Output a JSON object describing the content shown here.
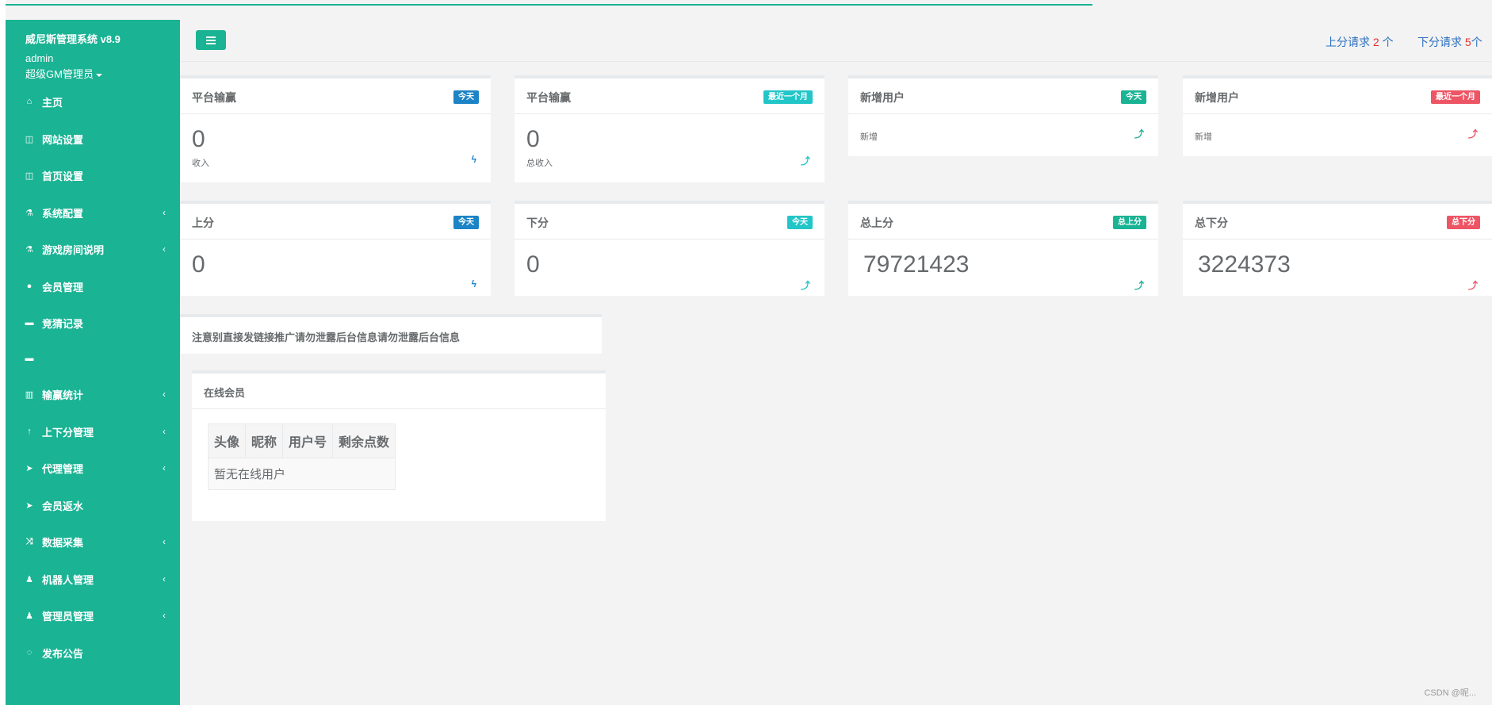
{
  "app": {
    "title": "威尼斯管理系统 v8.9",
    "user": "admin",
    "role": "超级GM管理员"
  },
  "nav": [
    {
      "label": "主页",
      "icon": "home-icon",
      "glyph": "⌂",
      "has_arrow": false,
      "arrow": ""
    },
    {
      "label": "网站设置",
      "icon": "columns-icon",
      "glyph": "◫",
      "has_arrow": false,
      "arrow": ""
    },
    {
      "label": "首页设置",
      "icon": "columns-icon",
      "glyph": "◫",
      "has_arrow": false,
      "arrow": ""
    },
    {
      "label": "系统配置",
      "icon": "flask-icon",
      "glyph": "⚗",
      "has_arrow": true,
      "arrow": "‹"
    },
    {
      "label": "游戏房间说明",
      "icon": "flask-icon",
      "glyph": "⚗",
      "has_arrow": true,
      "arrow": "‹"
    },
    {
      "label": "会员管理",
      "icon": "user-icon",
      "glyph": "●",
      "has_arrow": false,
      "arrow": ""
    },
    {
      "label": "竞猜记录",
      "icon": "car-icon",
      "glyph": "▬",
      "has_arrow": false,
      "arrow": ""
    },
    {
      "label": "",
      "icon": "car-icon",
      "glyph": "▬",
      "has_arrow": false,
      "arrow": ""
    },
    {
      "label": "输赢统计",
      "icon": "bar-chart-icon",
      "glyph": "▥",
      "has_arrow": true,
      "arrow": "‹"
    },
    {
      "label": "上下分管理",
      "icon": "level-up-icon",
      "glyph": "↑",
      "has_arrow": true,
      "arrow": "‹"
    },
    {
      "label": "代理管理",
      "icon": "paper-plane-icon",
      "glyph": "➤",
      "has_arrow": true,
      "arrow": "‹"
    },
    {
      "label": "会员返水",
      "icon": "paper-plane-icon",
      "glyph": "➤",
      "has_arrow": false,
      "arrow": ""
    },
    {
      "label": "数据采集",
      "icon": "random-icon",
      "glyph": "⤨",
      "has_arrow": true,
      "arrow": "‹"
    },
    {
      "label": "机器人管理",
      "icon": "male-icon",
      "glyph": "♟",
      "has_arrow": true,
      "arrow": "‹"
    },
    {
      "label": "管理员管理",
      "icon": "male-icon",
      "glyph": "♟",
      "has_arrow": true,
      "arrow": "‹"
    },
    {
      "label": "发布公告",
      "icon": "comment-icon",
      "glyph": "◌",
      "has_arrow": false,
      "arrow": ""
    }
  ],
  "header": {
    "up_request": {
      "label": "上分请求 ",
      "count": "2",
      "unit": " 个"
    },
    "down_request": {
      "label": "下分请求 ",
      "count": "5",
      "unit": "个"
    }
  },
  "stats_row1": [
    {
      "title": "平台输赢",
      "badge": "今天",
      "value": "0",
      "sub": "收入",
      "icon": "bolt-icon",
      "glyph": "ϟ"
    },
    {
      "title": "平台输赢",
      "badge": "最近一个月",
      "value": "0",
      "sub": "总收入",
      "icon": "level-up-icon",
      "glyph": "⤴"
    },
    {
      "title": "新增用户",
      "badge": "今天",
      "value": "",
      "sub": "新增",
      "icon": "level-up-icon",
      "glyph": "⤴"
    },
    {
      "title": "新增用户",
      "badge": "最近一个月",
      "value": "",
      "sub": "新增",
      "icon": "level-up-icon",
      "glyph": "⤴"
    }
  ],
  "stats_row2": [
    {
      "title": "上分",
      "badge": "今天",
      "value": "0",
      "icon": "bolt-icon",
      "glyph": "ϟ"
    },
    {
      "title": "下分",
      "badge": "今天",
      "value": "0",
      "icon": "level-up-icon",
      "glyph": "⤴"
    },
    {
      "title": "总上分",
      "badge": "总上分",
      "value": "79721423",
      "icon": "level-up-icon",
      "glyph": "⤴"
    },
    {
      "title": "总下分",
      "badge": "总下分",
      "value": "3224373",
      "icon": "level-up-icon",
      "glyph": "⤴"
    }
  ],
  "notice": "注意别直接发链接推广请勿泄露后台信息请勿泄露后台信息",
  "online": {
    "title": "在线会员",
    "columns": [
      "头像",
      "昵称",
      "用户号",
      "剩余点数"
    ],
    "empty": "暂无在线用户"
  },
  "watermark": "CSDN @呢...",
  "colors": {
    "primary": "#1ab394",
    "blue": "#1c84c6",
    "cyan": "#23c6c8",
    "red": "#ed5565"
  }
}
